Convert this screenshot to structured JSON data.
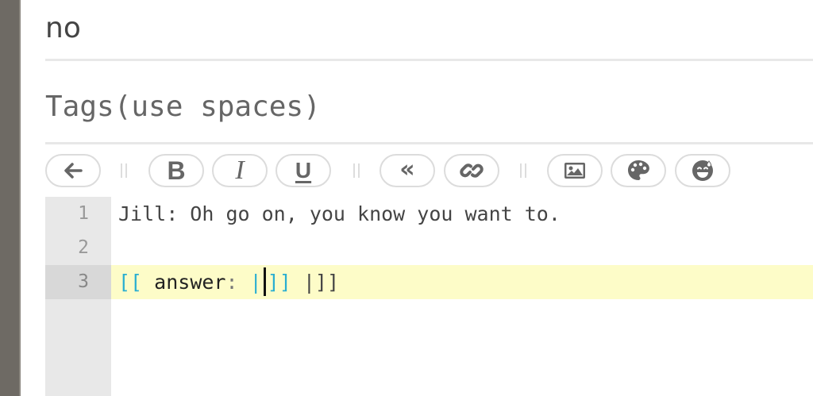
{
  "form": {
    "answer_value": "no",
    "tags_placeholder": "Tags(use spaces)"
  },
  "toolbar": {
    "buttons": [
      {
        "icon": "back-arrow-icon"
      },
      {
        "icon": "bold-icon",
        "label": "B"
      },
      {
        "icon": "italic-icon",
        "label": "I"
      },
      {
        "icon": "underline-icon",
        "label": "U"
      },
      {
        "icon": "quote-icon",
        "label": "«"
      },
      {
        "icon": "link-icon"
      },
      {
        "icon": "image-icon"
      },
      {
        "icon": "palette-icon"
      },
      {
        "icon": "emoji-icon"
      }
    ]
  },
  "editor": {
    "lines": [
      {
        "number": "1",
        "text": "Jill: Oh go on, you know you want to."
      },
      {
        "number": "2",
        "text": ""
      },
      {
        "number": "3",
        "open_brackets": "[[",
        "keyword": "answer",
        "colon": ":",
        "pipe": "|",
        "close_brackets": "]]",
        "trailing": "|]]"
      }
    ],
    "active_line": 3,
    "active_line_color": "#fdfcc8",
    "bracket_color": "#2aaed1"
  }
}
